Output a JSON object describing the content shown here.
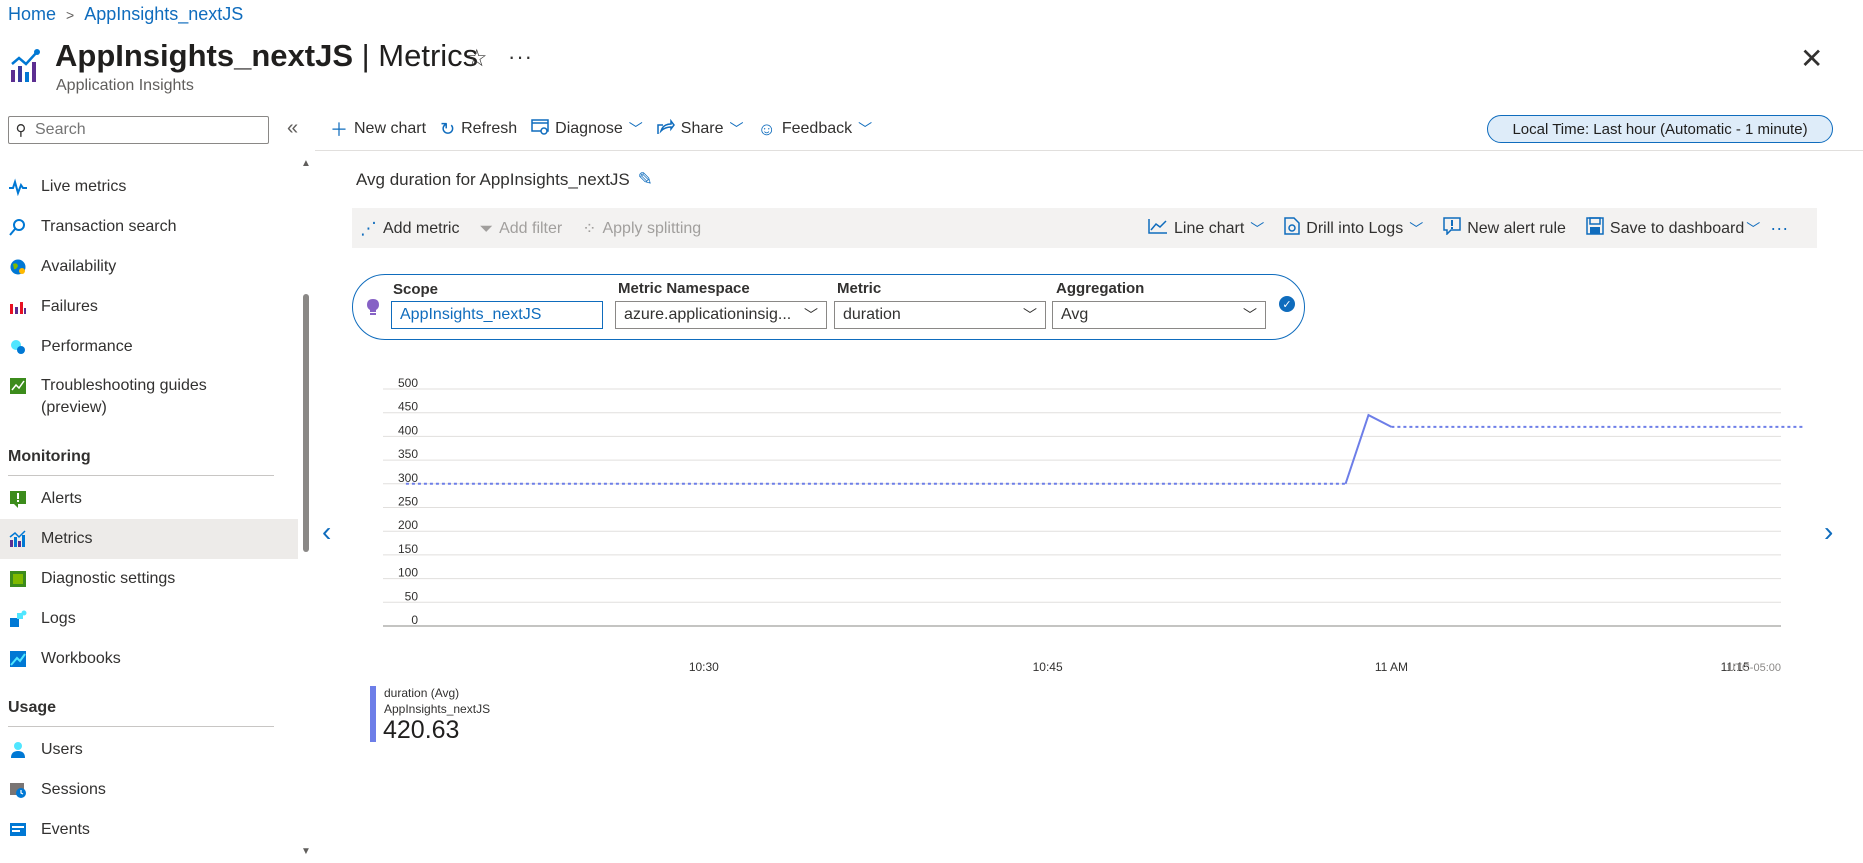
{
  "breadcrumb": {
    "home": "Home",
    "resource": "AppInsights_nextJS"
  },
  "header": {
    "resource_name": "AppInsights_nextJS",
    "separator": " | ",
    "page": "Metrics",
    "subtitle": "Application Insights"
  },
  "sidebar": {
    "search_placeholder": "Search",
    "items_top": [
      {
        "label": "Live metrics",
        "icon": "pulse-icon"
      },
      {
        "label": "Transaction search",
        "icon": "search-icon"
      },
      {
        "label": "Availability",
        "icon": "globe-icon"
      },
      {
        "label": "Failures",
        "icon": "failures-chart-icon"
      },
      {
        "label": "Performance",
        "icon": "performance-icon"
      },
      {
        "label": "Troubleshooting guides",
        "label2": "(preview)",
        "icon": "guide-icon"
      }
    ],
    "monitoring_header": "Monitoring",
    "monitoring_items": [
      {
        "label": "Alerts",
        "icon": "alert-icon"
      },
      {
        "label": "Metrics",
        "icon": "metrics-icon",
        "active": true
      },
      {
        "label": "Diagnostic settings",
        "icon": "diagnostic-icon"
      },
      {
        "label": "Logs",
        "icon": "logs-icon"
      },
      {
        "label": "Workbooks",
        "icon": "workbook-icon"
      }
    ],
    "usage_header": "Usage",
    "usage_items": [
      {
        "label": "Users",
        "icon": "user-icon"
      },
      {
        "label": "Sessions",
        "icon": "session-icon"
      },
      {
        "label": "Events",
        "icon": "events-icon"
      }
    ]
  },
  "toolbar": {
    "new_chart": "New chart",
    "refresh": "Refresh",
    "diagnose": "Diagnose",
    "share": "Share",
    "feedback": "Feedback",
    "time_range": "Local Time: Last hour (Automatic - 1 minute)"
  },
  "chart_panel": {
    "title": "Avg duration for AppInsights_nextJS",
    "add_metric": "Add metric",
    "add_filter": "Add filter",
    "apply_splitting": "Apply splitting",
    "line_chart": "Line chart",
    "drill_logs": "Drill into Logs",
    "new_alert": "New alert rule",
    "save_dashboard": "Save to dashboard",
    "more": "···"
  },
  "selector": {
    "scope_label": "Scope",
    "scope_value": "AppInsights_nextJS",
    "namespace_label": "Metric Namespace",
    "namespace_value": "azure.applicationinsig...",
    "metric_label": "Metric",
    "metric_value": "duration",
    "aggregation_label": "Aggregation",
    "aggregation_value": "Avg"
  },
  "legend": {
    "name": "duration (Avg)",
    "scope": "AppInsights_nextJS",
    "value": "420.63"
  },
  "colors": {
    "accent": "#0f6cbd",
    "series": "#6d7ee8"
  },
  "chart_data": {
    "type": "line",
    "ylim": [
      0,
      500
    ],
    "yticks": [
      "500",
      "450",
      "400",
      "350",
      "300",
      "250",
      "200",
      "150",
      "100",
      "50",
      "0"
    ],
    "xticks": [
      {
        "label": "10:30",
        "minute": 28
      },
      {
        "label": "10:45",
        "minute": 43
      },
      {
        "label": "11 AM",
        "minute": 58
      },
      {
        "label": "11:15",
        "minute": 73
      }
    ],
    "timezone": "UTC-05:00",
    "x_range_minutes": [
      14,
      75
    ],
    "series": [
      {
        "name": "duration (Avg)",
        "dashed_segments": [
          [
            [
              15,
              300
            ],
            [
              56,
              300
            ]
          ],
          [
            [
              58,
              420
            ],
            [
              76,
              420
            ]
          ]
        ],
        "solid_segment": [
          [
            56,
            300
          ],
          [
            57,
            445
          ],
          [
            58,
            420
          ]
        ]
      }
    ]
  }
}
